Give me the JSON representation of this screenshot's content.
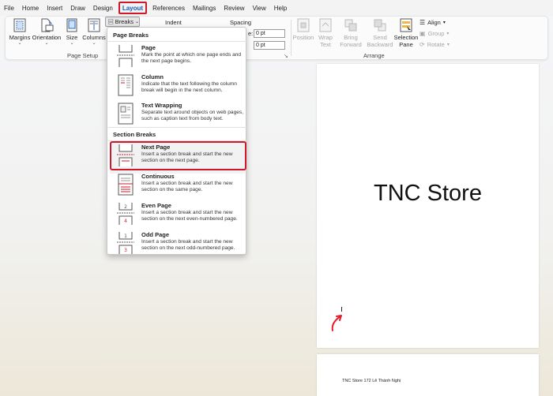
{
  "tabs": [
    "File",
    "Home",
    "Insert",
    "Draw",
    "Design",
    "Layout",
    "References",
    "Mailings",
    "Review",
    "View",
    "Help"
  ],
  "active_tab": "Layout",
  "ribbon": {
    "margins": "Margins",
    "orientation": "Orientation",
    "size": "Size",
    "columns": "Columns",
    "breaks": "Breaks",
    "page_setup": "Page Setup",
    "indent": "Indent",
    "spacing": "Spacing",
    "spacing_before_label": "e:",
    "spacing_before": "0 pt",
    "spacing_after": "0 pt",
    "position": "Position",
    "wrap_text_1": "Wrap",
    "wrap_text_2": "Text",
    "bring_forward_1": "Bring",
    "bring_forward_2": "Forward",
    "send_backward_1": "Send",
    "send_backward_2": "Backward",
    "selection_pane_1": "Selection",
    "selection_pane_2": "Pane",
    "align": "Align",
    "group": "Group",
    "rotate": "Rotate",
    "arrange": "Arrange"
  },
  "menu": {
    "page_breaks_heading": "Page Breaks",
    "section_breaks_heading": "Section Breaks",
    "items": [
      {
        "title": "Page",
        "desc": "Mark the point at which one page ends and the next page begins."
      },
      {
        "title": "Column",
        "desc": "Indicate that the text following the column break will begin in the next column."
      },
      {
        "title": "Text Wrapping",
        "desc": "Separate text around objects on web pages, such as caption text from body text."
      },
      {
        "title": "Next Page",
        "desc": "Insert a section break and start the new section on the next page."
      },
      {
        "title": "Continuous",
        "desc": "Insert a section break and start the new section on the same page."
      },
      {
        "title": "Even Page",
        "desc": "Insert a section break and start the new section on the next even-numbered page."
      },
      {
        "title": "Odd Page",
        "desc": "Insert a section break and start the new section on the next odd-numbered page."
      }
    ]
  },
  "document": {
    "title": "TNC Store",
    "page2_text": "TNC Store 172 Lê Thánh Nghị"
  },
  "colors": {
    "highlight_red": "#d1182b",
    "accent_blue": "#185abd",
    "annotation_red": "#e0202a"
  }
}
